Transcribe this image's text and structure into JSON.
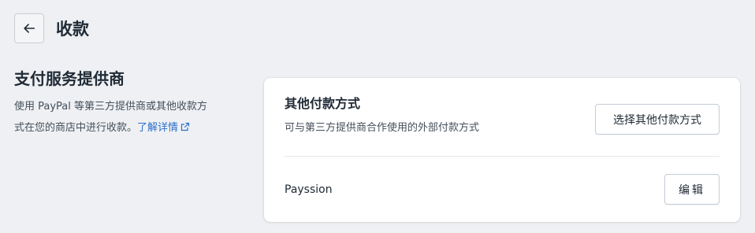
{
  "header": {
    "title": "收款",
    "back_icon": "arrow-left-icon"
  },
  "section": {
    "title": "支付服务提供商",
    "desc_line1": "使用 PayPal 等第三方提供商或其他收款方",
    "desc_line2": "式在您的商店中进行收款。",
    "learn_more": "了解详情",
    "learn_more_icon": "external-link-icon"
  },
  "card": {
    "title": "其他付款方式",
    "subtitle": "可与第三方提供商合作使用的外部付款方式",
    "choose_button": "选择其他付款方式",
    "provider_name": "Payssion",
    "edit_button": "编辑"
  },
  "colors": {
    "background": "#eef0f3",
    "card": "#ffffff",
    "link": "#2c6ecb",
    "text": "#212b36"
  }
}
